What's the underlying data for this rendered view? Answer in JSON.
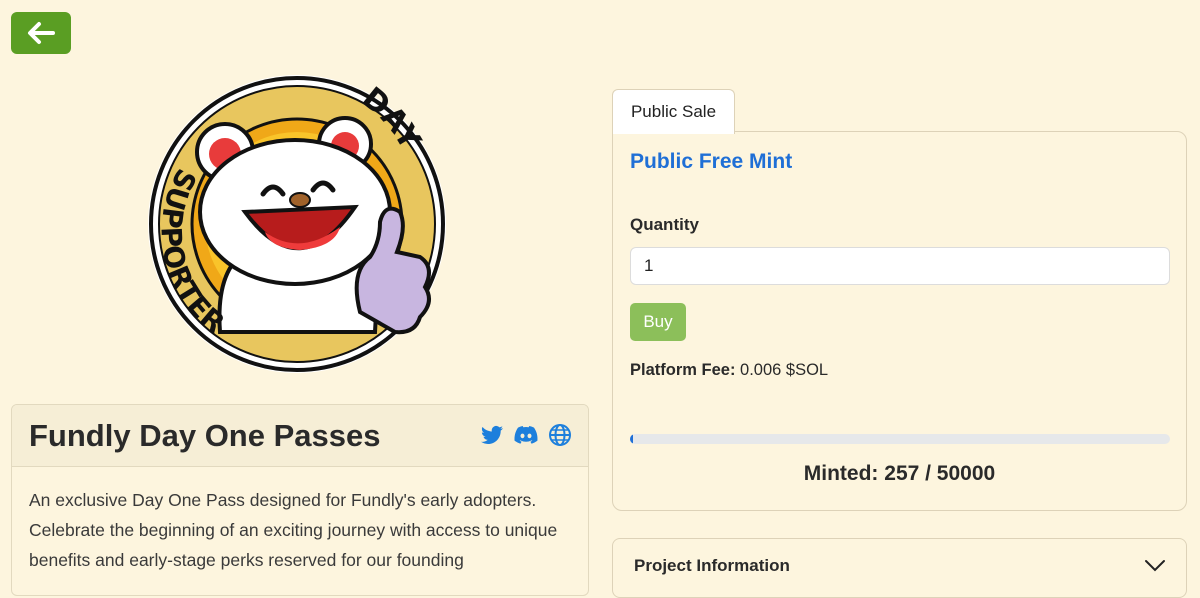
{
  "nav": {
    "back_icon": "arrow-left-icon"
  },
  "logo": {
    "arc_top": "DAY 1",
    "arc_left": "SUPPORTER",
    "alt": "Fundly Day 1 Supporter bear logo"
  },
  "collection": {
    "title": "Fundly Day One Passes",
    "socials": [
      {
        "name": "twitter-icon"
      },
      {
        "name": "discord-icon"
      },
      {
        "name": "globe-icon"
      }
    ],
    "description": "An exclusive Day One Pass designed for Fundly's early adopters. Celebrate the beginning of an exciting journey with access to unique benefits and early-stage perks reserved for our founding"
  },
  "sale": {
    "tab_label": "Public Sale",
    "title": "Public Free Mint",
    "quantity_label": "Quantity",
    "quantity_value": "1",
    "buy_label": "Buy",
    "fee_label": "Platform Fee:",
    "fee_value": "0.006 $SOL",
    "minted_text": "Minted: 257 / 50000",
    "minted": 257,
    "supply": 50000
  },
  "project": {
    "title": "Project Information"
  },
  "colors": {
    "background": "#fdf5de",
    "accent_green": "#5a9e23",
    "buy_green": "#8cbf5a",
    "link_blue": "#1f6fd6",
    "social_blue": "#1d7fdc"
  }
}
